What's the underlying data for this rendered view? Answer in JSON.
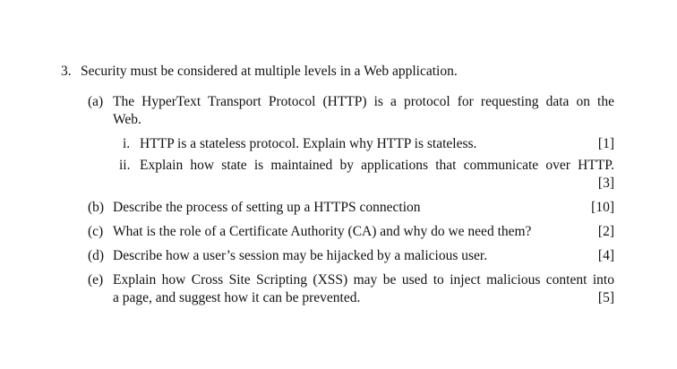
{
  "question": {
    "number": "3.",
    "text": "Security must be considered at multiple levels in a Web application.",
    "parts": [
      {
        "label": "(a)",
        "line1": "The HyperText Transport Protocol (HTTP) is a protocol for requesting data on the",
        "line2": "Web.",
        "subparts": [
          {
            "label": "i.",
            "text": "HTTP is a stateless protocol. Explain why HTTP is stateless.",
            "marks": "[1]"
          },
          {
            "label": "ii.",
            "text": "Explain how state is maintained by applications that communicate over HTTP.",
            "marks": "[3]"
          }
        ]
      },
      {
        "label": "(b)",
        "text": "Describe the process of setting up a HTTPS connection",
        "marks": "[10]"
      },
      {
        "label": "(c)",
        "text": "What is the role of a Certificate Authority (CA) and why do we need them?",
        "marks": "[2]"
      },
      {
        "label": "(d)",
        "text": "Describe how a user’s session may be hijacked by a malicious user.",
        "marks": "[4]"
      },
      {
        "label": "(e)",
        "line1": "Explain how Cross Site Scripting (XSS) may be used to inject malicious content into",
        "line2": "a page, and suggest how it can be prevented.",
        "marks": "[5]"
      }
    ]
  }
}
